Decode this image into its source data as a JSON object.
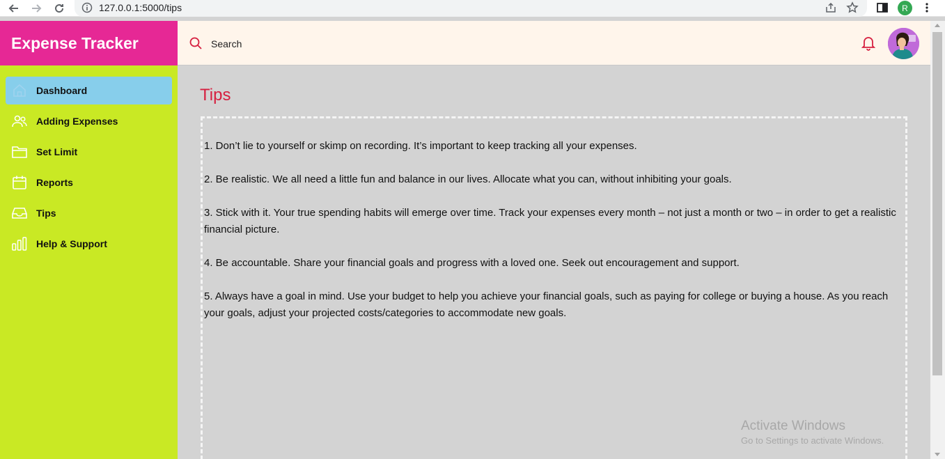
{
  "browser": {
    "url": "127.0.0.1:5000/tips",
    "profile_initial": "R"
  },
  "sidebar": {
    "brand": "Expense Tracker",
    "items": [
      {
        "label": "Dashboard",
        "icon": "home-icon",
        "active": true
      },
      {
        "label": "Adding Expenses",
        "icon": "users-icon",
        "active": false
      },
      {
        "label": "Set Limit",
        "icon": "folder-icon",
        "active": false
      },
      {
        "label": "Reports",
        "icon": "calendar-icon",
        "active": false
      },
      {
        "label": "Tips",
        "icon": "inbox-icon",
        "active": false
      },
      {
        "label": "Help & Support",
        "icon": "bar-chart-icon",
        "active": false
      }
    ]
  },
  "header": {
    "search_label": "Search"
  },
  "main": {
    "title": "Tips",
    "tips": [
      "1. Don’t lie to yourself or skimp on recording. It’s important to keep tracking all your expenses.",
      "2. Be realistic. We all need a little fun and balance in our lives. Allocate what you can, without inhibiting your goals.",
      "3. Stick with it. Your true spending habits will emerge over time. Track your expenses every month – not just a month or two – in order to get a realistic financial picture.",
      "4. Be accountable. Share your financial goals and progress with a loved one. Seek out encouragement and support.",
      "5. Always have a goal in mind. Use your budget to help you achieve your financial goals, such as paying for college or buying a house. As you reach your goals, adjust your projected costs/categories to accommodate new goals."
    ]
  },
  "watermark": {
    "line1": "Activate Windows",
    "line2": "Go to Settings to activate Windows."
  },
  "colors": {
    "sidebar_bg": "#c9e924",
    "brand_bg": "#e62895",
    "active_item": "#87ceeb",
    "topbar_bg": "#fff5eb",
    "title_color": "#d62040",
    "content_bg": "#d3d3d3"
  }
}
